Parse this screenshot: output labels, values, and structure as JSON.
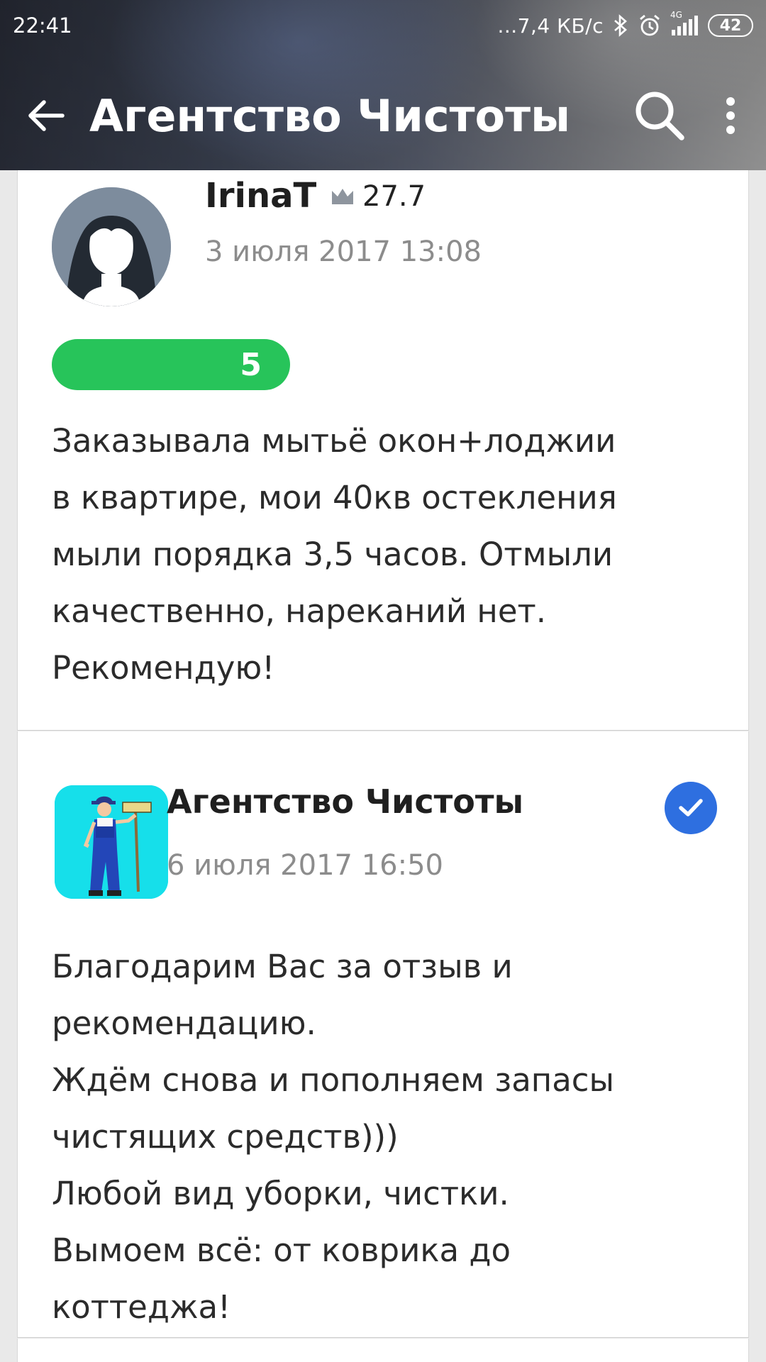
{
  "statusbar": {
    "time": "22:41",
    "network_speed": "...7,4 КБ/с",
    "network_type": "4G",
    "battery": "42"
  },
  "appbar": {
    "title": "Агентство Чистоты",
    "icons": [
      "back-arrow-icon",
      "search-icon",
      "more-vert-icon"
    ]
  },
  "review": {
    "author": "IrinaT",
    "rating": "27.7",
    "date": "3 июля 2017 13:08",
    "score": "5",
    "text": "Заказывала мытьё окон+лоджии\nв квартире, мои 40кв остекления\nмыли порядка 3,5 часов. Отмыли\nкачественно, нареканий нет.\nРекомендую!"
  },
  "reply": {
    "author": "Агентство Чистоты",
    "date": "6 июля 2017 16:50",
    "text": "Благодарим Вас за отзыв и\nрекомендацию.\nЖдём снова и пополняем запасы\nчистящих средств)))\nЛюбой вид уборки, чистки.\nВымоем всё: от коврика до\nкоттеджа!"
  },
  "colors": {
    "score_green": "#27c45a",
    "verified_blue": "#2e6fe0",
    "logo_cyan": "#16dfea"
  }
}
